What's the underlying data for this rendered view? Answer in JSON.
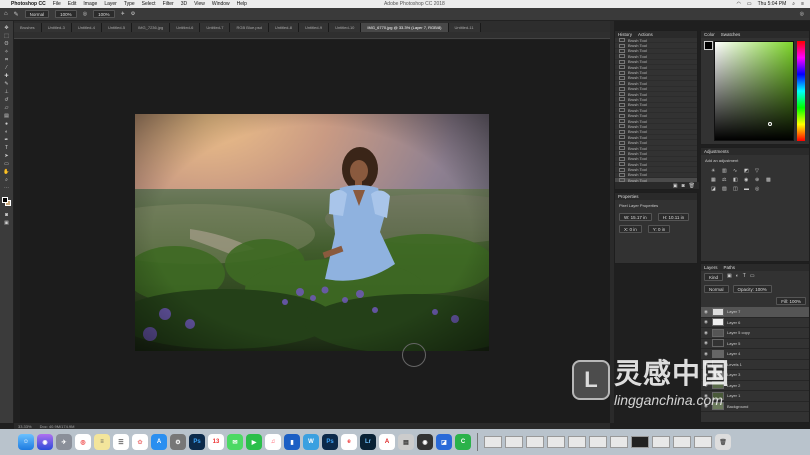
{
  "menubar": {
    "app": "Photoshop CC",
    "items": [
      "File",
      "Edit",
      "Image",
      "Layer",
      "Type",
      "Select",
      "Filter",
      "3D",
      "View",
      "Window",
      "Help"
    ],
    "window_title": "Adobe Photoshop CC 2018",
    "clock": "Thu 5:04 PM"
  },
  "options": {
    "mode": "Normal",
    "opacity": "100%",
    "flow": "100%"
  },
  "tabs": [
    {
      "label": "Brushes"
    },
    {
      "label": "Untitled-3"
    },
    {
      "label": "Untitled-4"
    },
    {
      "label": "Untitled-5"
    },
    {
      "label": "IMG_7236.jpg"
    },
    {
      "label": "Untitled-6"
    },
    {
      "label": "Untitled-7"
    },
    {
      "label": "RGB Blue.psd"
    },
    {
      "label": "Untitled-8"
    },
    {
      "label": "Untitled-9"
    },
    {
      "label": "Untitled-10"
    },
    {
      "label": "IMG_6770.jpg @ 33.3% (Layer 7, RGB/8)",
      "active": true
    },
    {
      "label": "Untitled-11"
    }
  ],
  "status": {
    "zoom": "33.33%",
    "doc": "Doc: 40.9M/174.9M"
  },
  "history": {
    "tabs": [
      "History",
      "Actions"
    ],
    "steps": [
      "Brush Tool",
      "Brush Tool",
      "Brush Tool",
      "Brush Tool",
      "Brush Tool",
      "Brush Tool",
      "Brush Tool",
      "Brush Tool",
      "Brush Tool",
      "Brush Tool",
      "Brush Tool",
      "Brush Tool",
      "Brush Tool",
      "Brush Tool",
      "Brush Tool",
      "Brush Tool",
      "Brush Tool",
      "Brush Tool",
      "Brush Tool",
      "Brush Tool",
      "Brush Tool",
      "Brush Tool",
      "Brush Tool",
      "Brush Tool",
      "Brush Tool",
      "Brush Tool",
      "Brush Tool"
    ]
  },
  "properties": {
    "title": "Properties",
    "subtitle": "Pixel Layer Properties",
    "w": "W: 15.17 in",
    "h": "H: 10.11 in",
    "x": "X: 0 in",
    "y": "Y: 0 in"
  },
  "color": {
    "tabs": [
      "Color",
      "Swatches"
    ],
    "hue_color": "#7dd62a"
  },
  "adjustments": {
    "title": "Adjustments",
    "subtitle": "Add an adjustment"
  },
  "layers": {
    "tabs": [
      "Layers",
      "Paths"
    ],
    "kind": "Kind",
    "blend": "Normal",
    "opacity": "Opacity: 100%",
    "fill": "Fill: 100%",
    "items": [
      "Layer 7",
      "Layer 6",
      "Layer 5 copy",
      "Layer 5",
      "Layer 4",
      "Levels 1",
      "Layer 3",
      "Layer 2",
      "Layer 1",
      "Background"
    ]
  },
  "watermark": {
    "cn": "灵感中国",
    "url": "lingganchina.com"
  },
  "dock": {
    "apps": [
      "finder",
      "siri",
      "launchpad",
      "chrome",
      "notes",
      "reminders",
      "photos",
      "app-store",
      "preferences",
      "photoshop",
      "calendar",
      "messages",
      "facetime",
      "itunes",
      "keynote",
      "warp",
      "ps",
      "ebay",
      "lightroom",
      "acrobat",
      "ai",
      "capture",
      "preview",
      "camtasia",
      "trash"
    ]
  }
}
